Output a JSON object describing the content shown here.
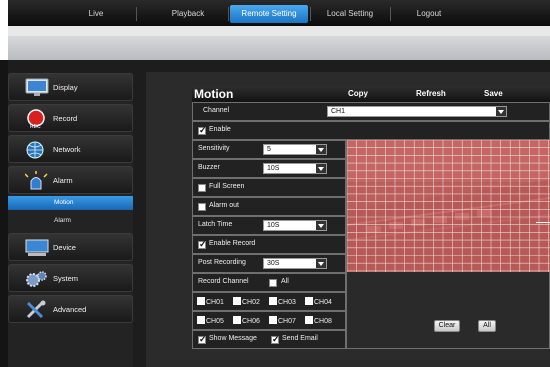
{
  "topnav": {
    "tabs": [
      {
        "label": "Live",
        "active": false
      },
      {
        "label": "Playback",
        "active": false
      },
      {
        "label": "Remote Setting",
        "active": true
      },
      {
        "label": "Local Setting",
        "active": false
      },
      {
        "label": "Logout",
        "active": false
      }
    ]
  },
  "sidebar": {
    "items": [
      {
        "label": "Display",
        "icon": "monitor-icon"
      },
      {
        "label": "Record",
        "icon": "record-icon"
      },
      {
        "label": "Network",
        "icon": "network-globe-icon"
      },
      {
        "label": "Alarm",
        "icon": "alarm-siren-icon"
      },
      {
        "label": "Device",
        "icon": "device-hdd-icon"
      },
      {
        "label": "System",
        "icon": "system-gear-icon"
      },
      {
        "label": "Advanced",
        "icon": "advanced-tools-icon"
      }
    ],
    "alarm_sub": [
      {
        "label": "Motion",
        "active": true
      },
      {
        "label": "Alarm",
        "active": false
      }
    ]
  },
  "panel": {
    "title": "Motion",
    "copy_label": "Copy",
    "refresh_label": "Refresh",
    "save_label": "Save",
    "channel_label": "Channel",
    "channel_value": "CH1",
    "enable_label": "Enable",
    "enable_checked": true,
    "sensitivity_label": "Sensitivity",
    "sensitivity_value": "5",
    "buzzer_label": "Buzzer",
    "buzzer_value": "10S",
    "full_screen_label": "Full Screen",
    "full_screen_checked": false,
    "alarm_out_label": "Alarm out",
    "alarm_out_checked": false,
    "latch_time_label": "Latch Time",
    "latch_time_value": "10S",
    "enable_record_label": "Enable Record",
    "enable_record_checked": true,
    "post_recording_label": "Post Recording",
    "post_recording_value": "30S",
    "record_channel_label": "Record Channel",
    "all_label": "All",
    "channels_row1": [
      "CH01",
      "CH02",
      "CH03",
      "CH04"
    ],
    "channels_row2": [
      "CH05",
      "CH06",
      "CH07",
      "CH08"
    ],
    "show_message_label": "Show Message",
    "show_message_checked": true,
    "send_email_label": "Send Email",
    "send_email_checked": true,
    "clear_label": "Clear",
    "all_button_label": "All"
  },
  "colors": {
    "accent": "#2a8ae0",
    "motion_overlay": "#e0605c",
    "panel_bg": "#2b2b2b"
  }
}
